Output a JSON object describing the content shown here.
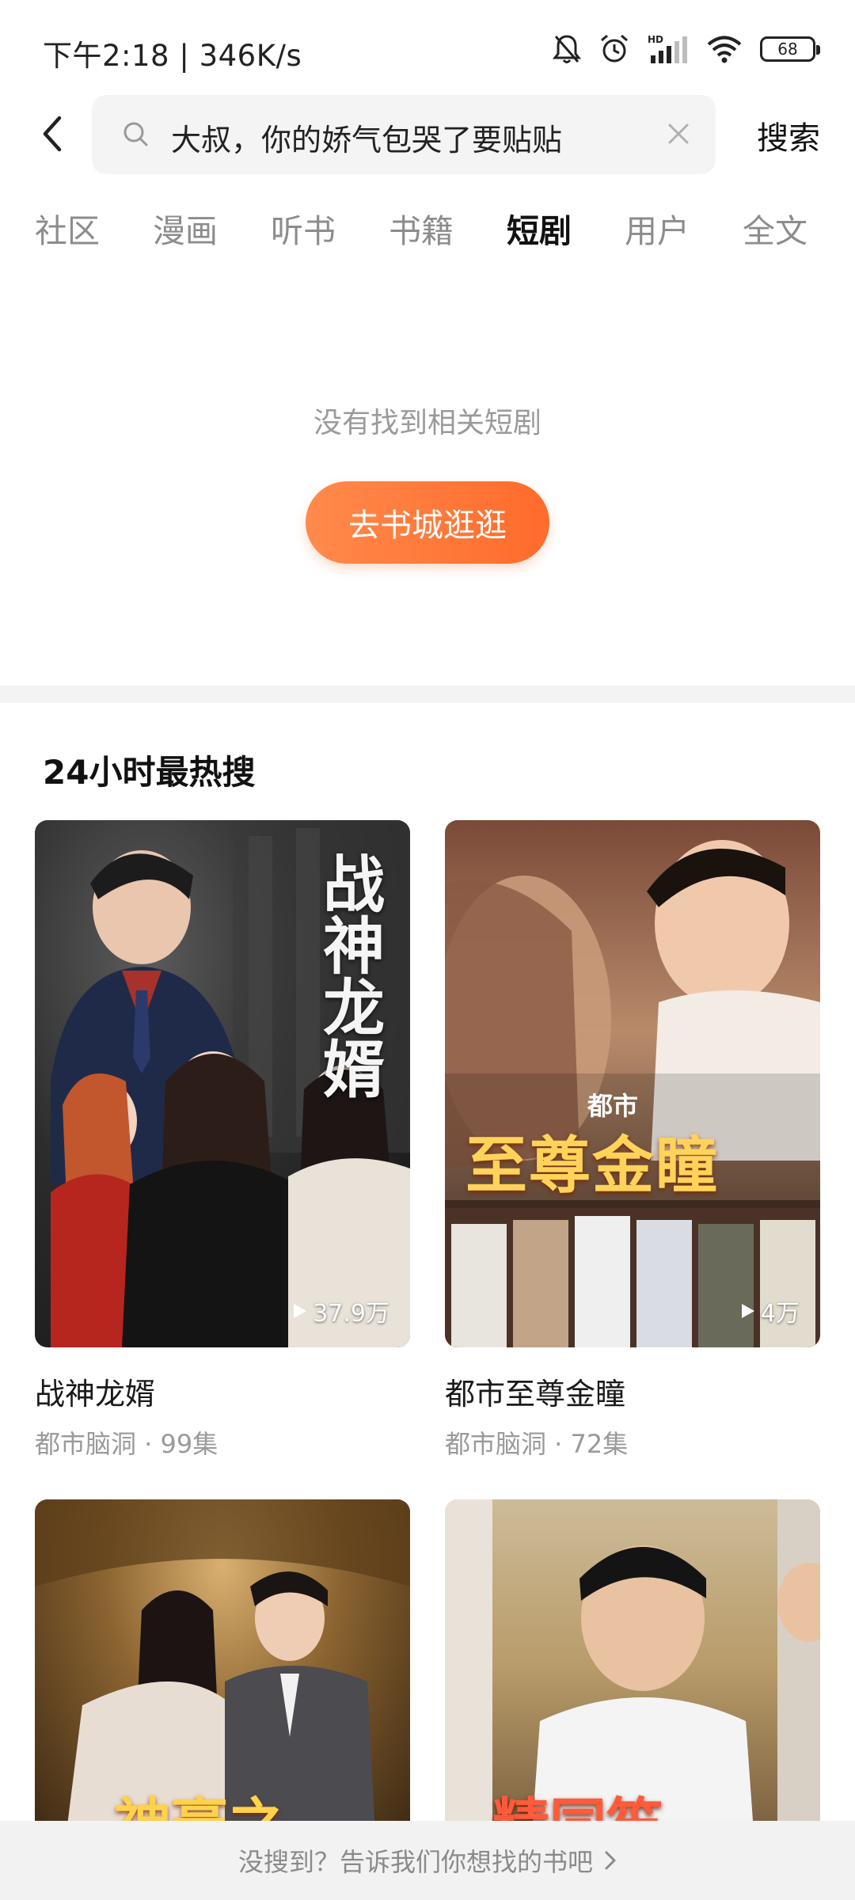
{
  "status_bar": {
    "time": "下午2:18",
    "speed": "346K/s",
    "battery": "68",
    "icons": [
      "mute-bell-icon",
      "alarm-icon",
      "hd-signal-icon",
      "wifi-icon",
      "battery-icon"
    ]
  },
  "search": {
    "query": "大叔，你的娇气包哭了要贴贴",
    "button_label": "搜索"
  },
  "tabs": [
    {
      "label": "社区"
    },
    {
      "label": "漫画"
    },
    {
      "label": "听书"
    },
    {
      "label": "书籍"
    },
    {
      "label": "短剧",
      "active": true
    },
    {
      "label": "用户"
    },
    {
      "label": "全文"
    }
  ],
  "empty_state": {
    "message": "没有找到相关短剧",
    "button_label": "去书城逛逛"
  },
  "hot": {
    "title": "24小时最热搜",
    "cards": [
      {
        "title": "战神龙婿",
        "meta": "都市脑洞 · 99集",
        "plays": "37.9万",
        "poster_text": "战神龙婿"
      },
      {
        "title": "都市至尊金瞳",
        "meta": "都市脑洞 · 72集",
        "plays": "4万",
        "poster_text": "至尊金瞳",
        "poster_subtext": "都市"
      },
      {
        "poster_text": "神豪之"
      },
      {
        "poster_text": "精同笙"
      }
    ]
  },
  "bottom_bar": {
    "text": "没搜到？告诉我们你想找的书吧"
  },
  "colors": {
    "accent": "#ff6b2b",
    "accent_light": "#ff8a4c",
    "text_primary": "#1a1a1a",
    "text_secondary": "#9a9a9a"
  }
}
